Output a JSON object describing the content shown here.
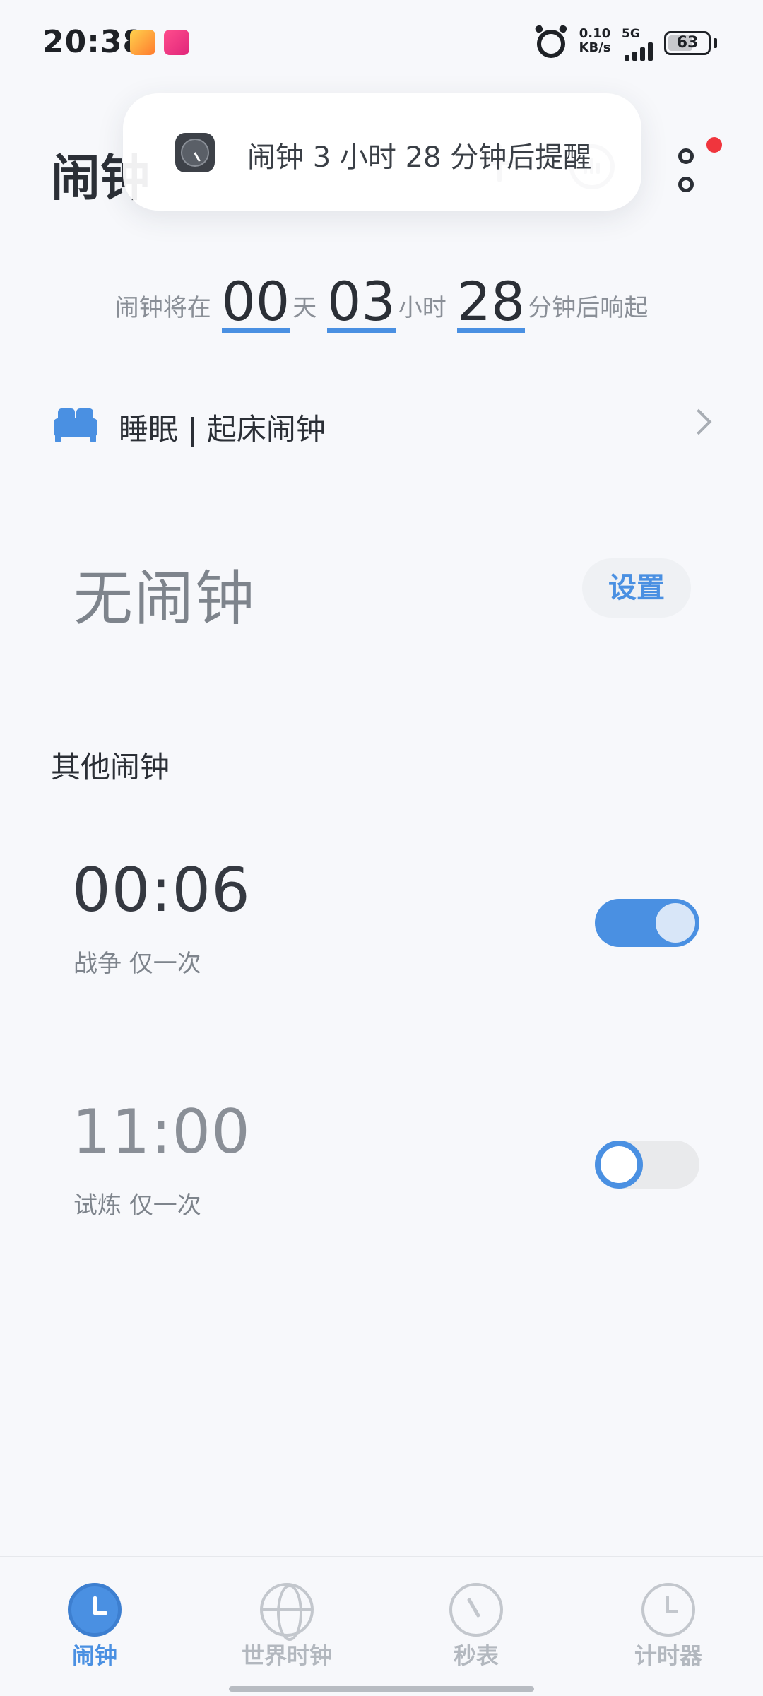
{
  "status_bar": {
    "time": "20:38",
    "net_speed_value": "0.10",
    "net_speed_unit": "KB/s",
    "network_type": "5G",
    "battery_level": "63"
  },
  "header": {
    "title": "闹钟"
  },
  "toast": {
    "text": "闹钟 3 小时 28 分钟后提醒"
  },
  "countdown": {
    "prefix": "闹钟将在",
    "days": "00",
    "days_label": "天",
    "hours": "03",
    "hours_label": "小时",
    "minutes": "28",
    "suffix": "分钟后响起"
  },
  "sleep": {
    "label": "睡眠 | 起床闹钟"
  },
  "no_alarm": {
    "text": "无闹钟",
    "button_label": "设置"
  },
  "other_alarms": {
    "title": "其他闹钟",
    "items": [
      {
        "time": "00:06",
        "label": "战争 仅一次",
        "enabled": true
      },
      {
        "time": "11:00",
        "label": "试炼 仅一次",
        "enabled": false
      }
    ]
  },
  "bottom_nav": {
    "items": [
      {
        "label": "闹钟",
        "icon": "alarm-clock-icon",
        "active": true
      },
      {
        "label": "世界时钟",
        "icon": "globe-icon",
        "active": false
      },
      {
        "label": "秒表",
        "icon": "stopwatch-icon",
        "active": false
      },
      {
        "label": "计时器",
        "icon": "timer-icon",
        "active": false
      }
    ]
  },
  "colors": {
    "accent": "#4a90e2",
    "background": "#f7f8fb",
    "badge_red": "#f0353d"
  }
}
